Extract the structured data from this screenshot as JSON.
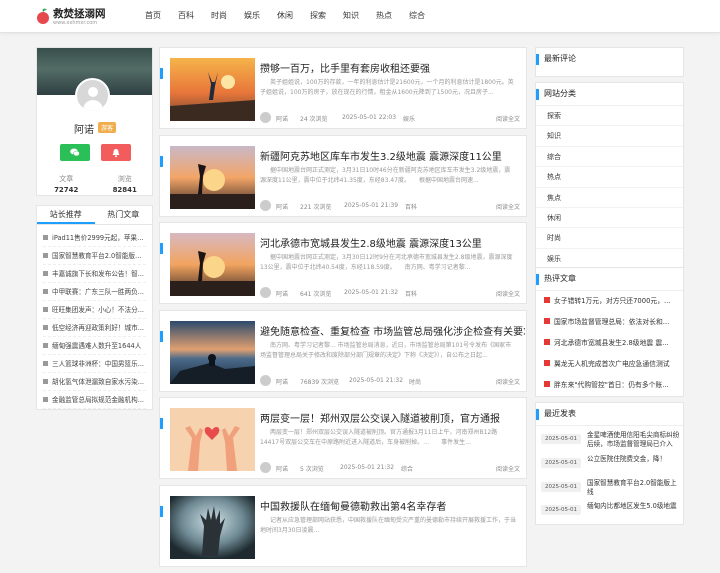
{
  "site": {
    "title": "救焚拯溺网",
    "subtitle": "www.xxhmxr.com"
  },
  "nav": [
    "首页",
    "百科",
    "时尚",
    "娱乐",
    "休闲",
    "探索",
    "知识",
    "热点",
    "综合"
  ],
  "profile": {
    "name": "阿诺",
    "badge": "游客",
    "stats": [
      {
        "label": "文章",
        "value": "72742"
      },
      {
        "label": "浏览",
        "value": "82841"
      }
    ]
  },
  "tabs": [
    "站长推荐",
    "热门文章"
  ],
  "recommend": [
    "iPad11售价2999元起，苹果手...",
    "国家智慧教育平台2.0智能版上线",
    "丰嘉诚旗下长和发布公告！智...",
    "中甲联赛：广东三队一胜两负...",
    "旺旺集团发声：小心！不法分...",
    "低空经济再迎政策利好！城市...",
    "缅甸强震遇难人数升至1644人",
    "三人篮球非洲杯：中国男篮乐...",
    "胡化氢气体泄漏致自家水污染...",
    "金融监管总局拟规范金融机构..."
  ],
  "articles": [
    {
      "title": "攒够一百万，比手里有套房收租还要强",
      "desc": "英子姐姐说，100万的存款，一年的利息估计是21600元，一个月的利息估计是1800元。英子姐姐说，100万的房子，放在现在的行情，租金从1600元降到了1500元，况且房子...",
      "author": "阿诺",
      "views": "24 次浏览",
      "date": "2025-05-01 22:03",
      "category": "娱乐",
      "more": "阅读全文"
    },
    {
      "title": "新疆阿克苏地区库车市发生3.2级地震 震源深度11公里",
      "desc": "据中国地震台网正式测定，3月31日10时46分在新疆阿克苏地区库车市发生3.2级地震，震源深度11公里，震中位于北纬41.35度，东经83.47度。　　根据中国地震台网速...",
      "author": "阿诺",
      "views": "221 次浏览",
      "date": "2025-05-01 21:39",
      "category": "百科",
      "more": "阅读全文"
    },
    {
      "title": "河北承德市宽城县发生2.8级地震 震源深度13公里",
      "desc": "据中国地震台网正式测定，3月30日12时9分在河北承德市宽城县发生2.8级地震，震源深度13公里，震中位于北纬40.54度，东经118.59度。　　南方网、粤学习记者黎...",
      "author": "阿诺",
      "views": "641 次浏览",
      "date": "2025-05-01 21:32",
      "category": "百科",
      "more": "阅读全文"
    },
    {
      "title": "避免随意检查、重复检查 市场监管总局强化涉企检查有关要求",
      "desc": "南方网、粤学习记者黎... 市场监管总局消息，近日，市场监管总局第101号令发布《国家市场监督管理总局关于修改和废除部分部门规章的决定》下称《决定》），自公布之日起...",
      "author": "阿诺",
      "views": "76839 次浏览",
      "date": "2025-05-01 21:32",
      "category": "时尚",
      "more": "阅读全文"
    },
    {
      "title": "两层变一层！郑州双层公交误入隧道被削顶，官方通报",
      "desc": "两层变一层！郑州双层公交误入隧道被削顶。官方通报3月11日上午，河南郑州B12路14417号双层公交车在中原路附近进入隧道后，车身被削掉。…　　事件发生…",
      "author": "阿诺",
      "views": "5 次浏览",
      "date": "2025-05-01 21:32",
      "category": "综合",
      "more": "阅读全文"
    },
    {
      "title": "中国救援队在缅甸曼德勒救出第4名幸存者",
      "desc": "记者从应急管理部网站获悉，中国救援队在缅甸受灾严重的曼德勒市持续开展救援工作，于当地时间3月30日凌晨…",
      "author": "阿诺",
      "views": "",
      "date": "",
      "category": "",
      "more": ""
    }
  ],
  "right": {
    "latest_comments": "最新评论",
    "categories_title": "网站分类",
    "categories": [
      "探索",
      "知识",
      "综合",
      "热点",
      "焦点",
      "休闲",
      "时尚",
      "娱乐"
    ],
    "hot_title": "热评文章",
    "hot": [
      "女子错转1万元，对方只还7000元，...",
      "国家市场监督管理总局：依法对长和...",
      "河北承德市宽城县发生2.8级地震 震...",
      "翼龙无人机完成首次广电应急通信测试",
      "胖东来\"代购管控\"首日：仍有多个账..."
    ],
    "latest_title": "最近发表",
    "latest": [
      {
        "date": "2025-05-01",
        "title": "金星啤酒使用信阳毛尖商标纠纷后续，市场监督管理局已介入"
      },
      {
        "date": "2025-05-01",
        "title": "公立医院住院费交金，降！"
      },
      {
        "date": "2025-05-01",
        "title": "国家智慧教育平台2.0智能版上线"
      },
      {
        "date": "2025-05-01",
        "title": "缅甸内比都地区发生5.0级地震"
      }
    ]
  },
  "colors": {
    "accent": "#1e9fff",
    "wechat": "#2bbf57",
    "alert": "#f25c5c",
    "badge": "#f0ad4e",
    "hot_marker": "#e53935"
  }
}
